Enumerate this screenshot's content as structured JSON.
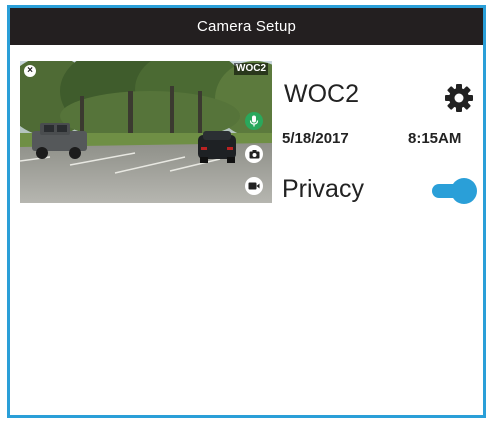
{
  "header": {
    "title": "Camera Setup"
  },
  "camera": {
    "thumbnail_label": "WOC2",
    "name": "WOC2",
    "date": "5/18/2017",
    "time": "8:15AM"
  },
  "privacy": {
    "label": "Privacy",
    "enabled": true
  },
  "colors": {
    "accent": "#2a9fd8",
    "header_bg": "#231f20",
    "mic_active": "#2aa85c"
  },
  "icons": {
    "close": "close-icon",
    "mic": "microphone-icon",
    "snapshot": "snapshot-icon",
    "record": "video-record-icon",
    "settings": "gear-icon"
  }
}
